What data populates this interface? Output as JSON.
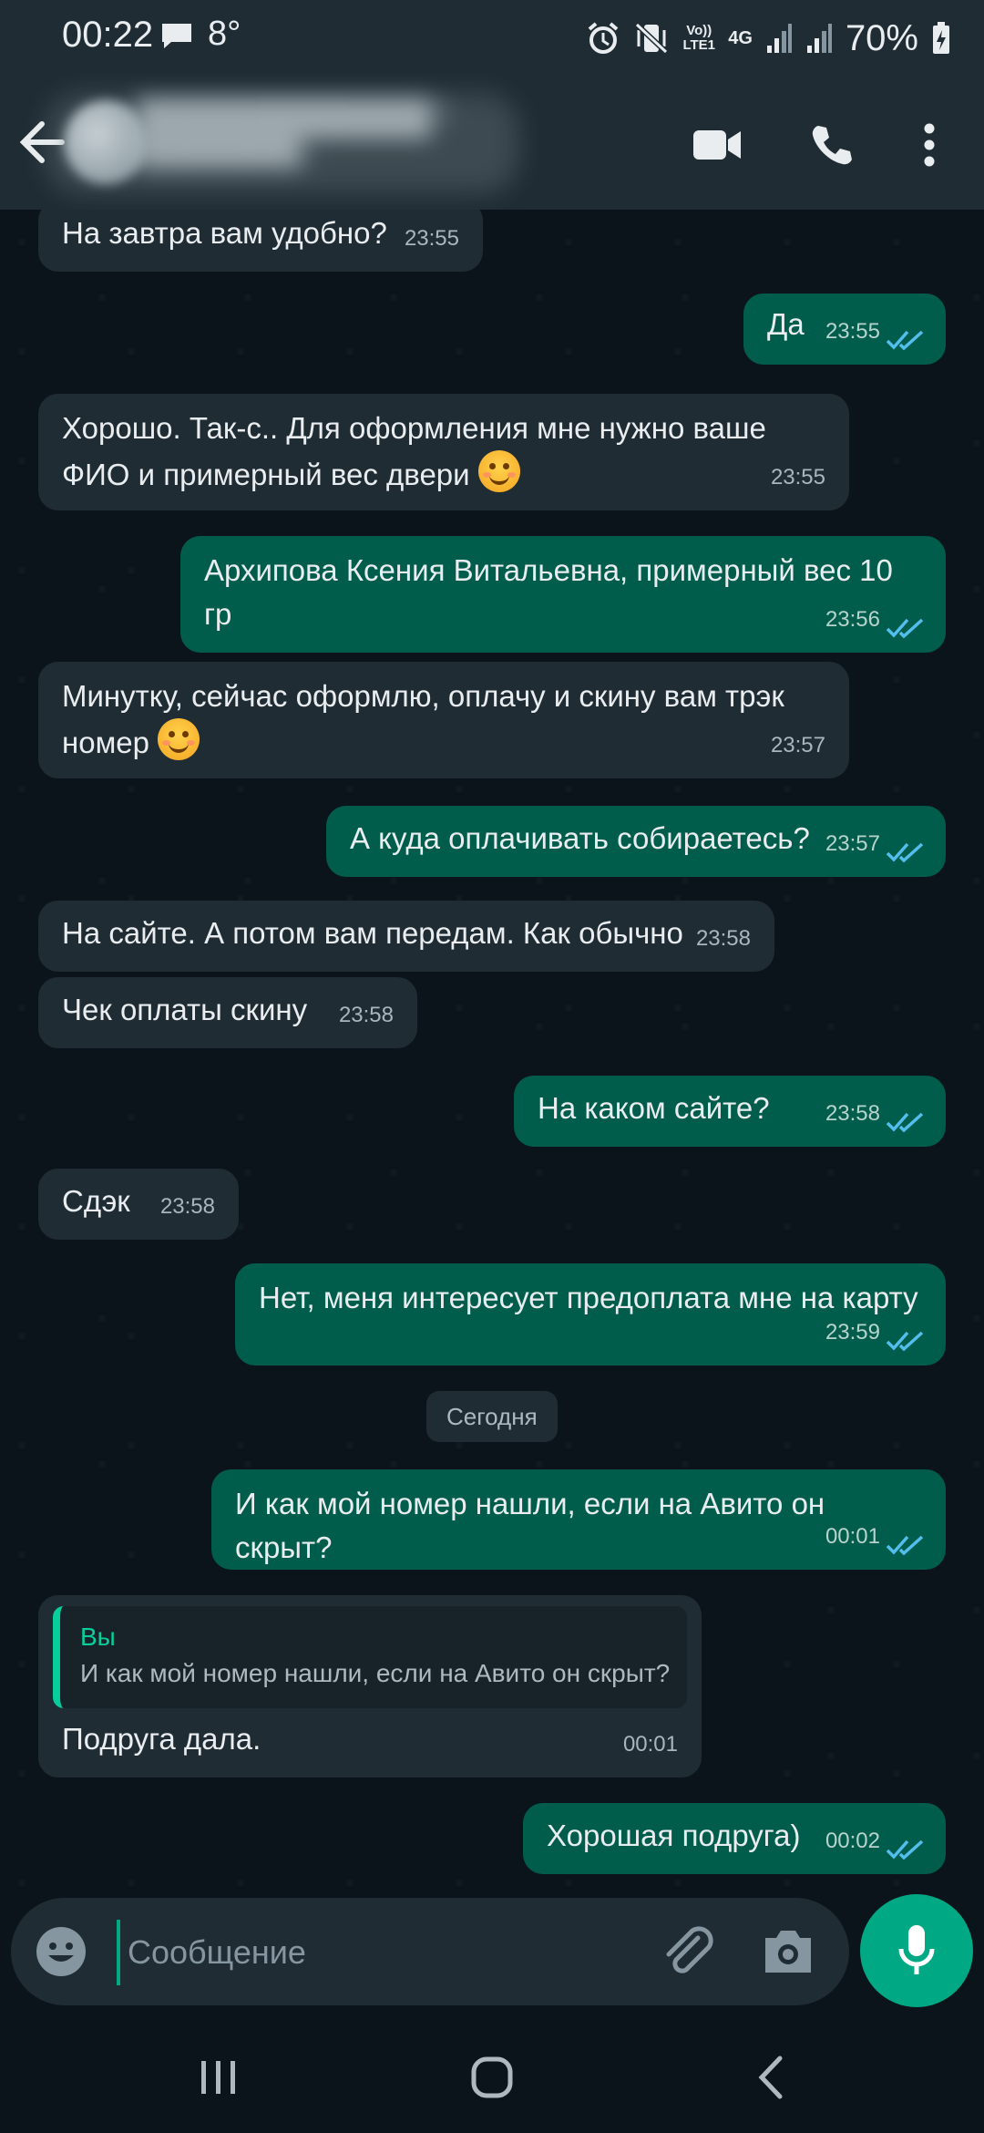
{
  "status_bar": {
    "time": "00:22",
    "temperature": "8°",
    "network": "4G",
    "volte": "Vo)) LTE1",
    "battery": "70%"
  },
  "header": {
    "contact_name": "████████████?",
    "contact_status": "█████████у"
  },
  "chat": {
    "messages": [
      {
        "dir": "in",
        "text": "На завтра вам удобно?",
        "time": "23:55"
      },
      {
        "dir": "out",
        "text": "Да",
        "time": "23:55",
        "status": "read"
      },
      {
        "dir": "in",
        "text": "Хорошо. Так-с.. Для оформления мне нужно ваше ФИО и примерный вес двери",
        "emoji": "smiling-face-emoji",
        "time": "23:55"
      },
      {
        "dir": "out",
        "text": "Архипова Ксения Витальевна, примерный вес 10 гр",
        "time": "23:56",
        "status": "read"
      },
      {
        "dir": "in",
        "text": "Минутку, сейчас оформлю, оплачу и скину вам трэк номер",
        "emoji": "smiling-eyes-emoji",
        "time": "23:57"
      },
      {
        "dir": "out",
        "text": "А куда оплачивать собираетесь?",
        "time": "23:57",
        "status": "read"
      },
      {
        "dir": "in",
        "text": "На сайте. А потом вам передам. Как обычно",
        "time": "23:58"
      },
      {
        "dir": "in",
        "text": "Чек оплаты скину",
        "time": "23:58"
      },
      {
        "dir": "out",
        "text": "На каком сайте?",
        "time": "23:58",
        "status": "read"
      },
      {
        "dir": "in",
        "text": "Сдэк",
        "time": "23:58"
      },
      {
        "dir": "out",
        "text": "Нет, меня интересует предоплата мне на карту",
        "time": "23:59",
        "status": "read"
      },
      {
        "dir": "out",
        "text": "И как мой номер нашли, если на Авито он скрыт?",
        "time": "00:01",
        "status": "read"
      },
      {
        "dir": "in",
        "quote_author": "Вы",
        "quote_text": "И как мой номер нашли, если на Авито он скрыт?",
        "text": "Подруга дала.",
        "time": "00:01"
      },
      {
        "dir": "out",
        "text": "Хорошая подруга)",
        "time": "00:02",
        "status": "read"
      }
    ],
    "date_separator": "Сегодня"
  },
  "composer": {
    "placeholder": "Сообщение"
  },
  "colors": {
    "incoming_bubble": "#202c33",
    "outgoing_bubble": "#005c4b",
    "accent": "#00a884",
    "read_ticks": "#53bdeb"
  }
}
